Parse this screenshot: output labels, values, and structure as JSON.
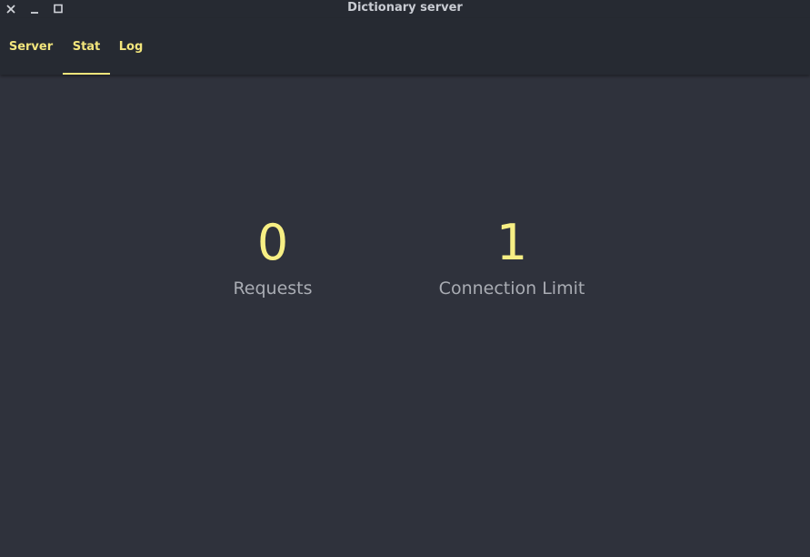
{
  "window": {
    "title": "Dictionary server",
    "controls": [
      {
        "name": "close-icon"
      },
      {
        "name": "minimize-icon"
      },
      {
        "name": "maximize-icon"
      }
    ]
  },
  "tabs": [
    {
      "label": "Server",
      "active": false
    },
    {
      "label": "Stat",
      "active": true
    },
    {
      "label": "Log",
      "active": false
    }
  ],
  "stats": [
    {
      "value": "0",
      "label": "Requests"
    },
    {
      "value": "1",
      "label": "Connection Limit"
    }
  ],
  "colors": {
    "accent": "#f2e57c",
    "background": "#2f323c",
    "toolbar": "#262a32",
    "label": "#a9acb3"
  }
}
